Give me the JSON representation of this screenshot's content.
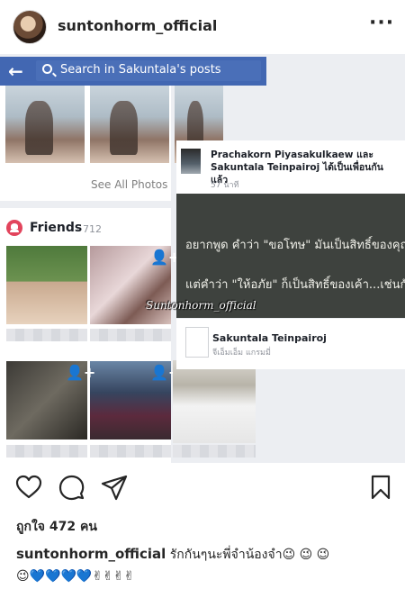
{
  "post": {
    "username": "suntonhorm_official",
    "likes_text": "ถูกใจ 472 คน",
    "caption_user": "suntonhorm_official",
    "caption_text": "รักกันๆนะพี่จำน้องจำ😉 😉 😉",
    "caption_line2": "😉💙💙💙💙✌✌✌✌"
  },
  "screenshot": {
    "search_placeholder": "Search in Sakuntala's posts",
    "see_all_photos": "See All Photos",
    "friends_title": "Friends",
    "friends_count": "· 712",
    "notification_text": "Prachakorn Piyasakulkaew และ Sakuntala Teinpairoj ได้เป็นเพื่อนกันแล้ว",
    "notification_time": "57 นาที",
    "quote_line1": "อยากพูด คำว่า \"ขอโทษ\"  มันเป็นสิทธิ์ของคุณ",
    "quote_line2": "แต่คำว่า \"ให้อภัย\"  ก็เป็นสิทธิ์ของเค้า...เช่นกัน",
    "share_name": "Sakuntala Teinpairoj",
    "share_sub": "จีเอ็มเอ็ม แกรมมี่",
    "watermark": "Suntonhorm_official",
    "thumb_label": "คิดถึง"
  },
  "icons": {
    "more": "more-icon",
    "like": "heart-icon",
    "comment": "comment-icon",
    "share": "send-icon",
    "save": "bookmark-icon"
  },
  "colors": {
    "facebook_blue": "#4267b2",
    "friends_red": "#e2445c"
  }
}
